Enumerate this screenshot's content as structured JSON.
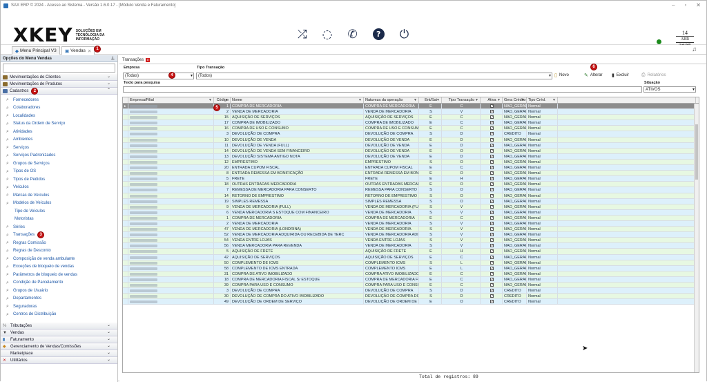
{
  "window_title": "SAX ERP © 2024 - Acesso ao Sistema - Versão 1.6.0.17 - [Módulo Venda e Faturamento]",
  "logo": {
    "mark": "XKEY",
    "tagline": "SOLUÇÕES EM TECNOLOGIA DA INFORMAÇÃO"
  },
  "date": {
    "day": "14",
    "month": "ABR",
    "year": "2025"
  },
  "tabs": [
    {
      "label": "Menu Principal V3"
    },
    {
      "label": "Vendas"
    }
  ],
  "badges": {
    "b1": "1",
    "b2": "2",
    "b3": "3",
    "b4": "4",
    "b5": "5",
    "b6": "6"
  },
  "sidebar": {
    "title": "Opções do Menu Vendas",
    "sections_top": [
      {
        "label": "Movimentações de Clientes"
      },
      {
        "label": "Movimentações de Produtos"
      },
      {
        "label": "Cadastros"
      }
    ],
    "items": [
      "Fornecedores",
      "Colaboradores",
      "Localidades",
      "Status da Ordem de Serviço",
      "Atividades",
      "Ambientes",
      "Serviços",
      "Serviços Padronizados",
      "Grupos de Serviços",
      "Tipos de OS",
      "Tipos de Pedidos",
      "Veículos",
      "Marcas de Veículos",
      "Modelos de Veículos",
      "Tipo de Veículos",
      "Motoristas",
      "Séries",
      "Transações",
      "Regras Comissão",
      "Regras de Desconto",
      "Composição de venda ambulante",
      "Exceções de bloqueio de vendas",
      "Parâmetros de bloqueio de vendas",
      "Condição de Parcelamento",
      "Grupos de Usuário",
      "Departamentos",
      "Seguradoras",
      "Centros de Distribuição"
    ],
    "sections_bottom": [
      {
        "label": "Tributações"
      },
      {
        "label": "Vendas"
      },
      {
        "label": "Faturamento"
      },
      {
        "label": "Gerenciamento de Vendas/Comissões"
      },
      {
        "label": "Marketplace"
      },
      {
        "label": "Utilitários"
      }
    ]
  },
  "content": {
    "tab_label": "Transações",
    "empresa_label": "Empresa",
    "empresa_value": "(Todas)",
    "tipo_label": "Tipo Transação",
    "tipo_value": "(Todos)",
    "search_label": "Texto para pesquisa",
    "situacao_label": "Situação",
    "situacao_value": "ATIVOS",
    "buttons": {
      "novo": "Novo",
      "alterar": "Alterar",
      "excluir": "Excluir",
      "relatorios": "Relatórios"
    },
    "columns": [
      "Empresa/Filial",
      "Código",
      "Nome",
      "Natureza da operação",
      "Ent/Sai",
      "Tipo Transação",
      "Ativa",
      "Gera Crédito",
      "Tipo Créd."
    ],
    "rows": [
      [
        "1",
        "COMPRA DE MERCADORIA",
        "COMPRA DE MERCADORIA",
        "E",
        "C",
        "NAO_GERAR",
        "Normal"
      ],
      [
        "2",
        "VENDA DE MERCADORIA",
        "VENDA DE MERCADORIA",
        "S",
        "V",
        "NAO_GERAR",
        "Normal"
      ],
      [
        "15",
        "AQUISIÇÃO DE SERVIÇOS",
        "AQUISIÇÃO DE SERVIÇOS",
        "E",
        "C",
        "NAO_GERAR",
        "Normal"
      ],
      [
        "17",
        "COMPRA DE IMOBILIZADO",
        "COMPRA DE IMOBILIZADO",
        "E",
        "C",
        "NAO_GERAR",
        "Normal"
      ],
      [
        "16",
        "COMPRA DE USO E CONSUMO",
        "COMPRA DE USO E CONSUM",
        "E",
        "C",
        "NAO_GERAR",
        "Normal"
      ],
      [
        "3",
        "DEVOLUÇÃO DE COMPRA",
        "DEVOLUÇÃO DE COMPRA",
        "S",
        "D",
        "CREDITO",
        "Normal"
      ],
      [
        "10",
        "DEVOLUÇÃO DE VENDA",
        "DEVOLUÇÃO DE VENDA",
        "E",
        "D",
        "NAO_GERAR",
        "Normal"
      ],
      [
        "11",
        "DEVOLUÇÃO DE VENDA (FULL)",
        "DEVOLUÇÃO DE VENDA",
        "E",
        "D",
        "NAO_GERAR",
        "Normal"
      ],
      [
        "14",
        "DEVOLUÇÃO DE VENDA SEM FINANCEIRO",
        "DEVOLUÇÃO DE VENDA",
        "E",
        "O",
        "NAO_GERAR",
        "Normal"
      ],
      [
        "13",
        "DEVOLUÇÃO SISTEMA ANTIGO NOTA",
        "DEVOLUÇÃO DE VENDA",
        "E",
        "D",
        "NAO_GERAR",
        "Normal"
      ],
      [
        "12",
        "EMPRESTIMO",
        "EMPRESTIMO",
        "S",
        "O",
        "NAO_GERAR",
        "Normal"
      ],
      [
        "20",
        "ENTRADA CUPOM FISCAL",
        "ENTRADA CUPOM FISCAL",
        "E",
        "C",
        "NAO_GERAR",
        "Normal"
      ],
      [
        "8",
        "ENTRADA REMESSA EM BONIFICAÇÃO",
        "ENTRADA REMESSA EM BONII",
        "E",
        "O",
        "NAO_GERAR",
        "Normal"
      ],
      [
        "5",
        "FRETE",
        "FRETE",
        "E",
        "H",
        "NAO_GERAR",
        "Normal"
      ],
      [
        "18",
        "OUTRAS ENTRADAS MERCADORIA",
        "OUTRAS ENTRADAS MERCAD",
        "E",
        "O",
        "NAO_GERAR",
        "Normal"
      ],
      [
        "7",
        "REMESSA DE MERCADORIA PARA CONSERTO",
        "REMESSA PARA CONSERTO",
        "S",
        "O",
        "NAO_GERAR",
        "Normal"
      ],
      [
        "14",
        "RETORNO DE EMPRESTIMO",
        "RETORNO DE EMPRESTIMO",
        "S",
        "O",
        "NAO_GERAR",
        "Normal"
      ],
      [
        "19",
        "SIMPLES REMESSA",
        "SIMPLES REMESSA",
        "S",
        "O",
        "NAO_GERAR",
        "Normal"
      ],
      [
        "9",
        "VENDA DE MERCADORIA (FULL)",
        "VENDA DE MERCADORIA (FUI",
        "S",
        "V",
        "NAO_GERAR",
        "Normal"
      ],
      [
        "6",
        "VENDA MERCADORIA S ESTOQUE COM FINANCEIRO",
        "VENDA DE MERCADORIA",
        "S",
        "V",
        "NAO_GERAR",
        "Normal"
      ],
      [
        "1",
        "COMPRA DE MERCADORIA",
        "COMPRA DE MERCADORIA",
        "E",
        "C",
        "NAO_GERAR",
        "Normal"
      ],
      [
        "2",
        "VENDA DE MERCADORIA",
        "VENDA DE MERCADORIA",
        "S",
        "V",
        "NAO_GERAR",
        "Normal"
      ],
      [
        "47",
        "VENDA DE MERCADORIA (LONDRINA)",
        "VENDA DE MERCADORIA",
        "S",
        "V",
        "NAO_GERAR",
        "Normal"
      ],
      [
        "52",
        "VENDA DE MERCADORIA ADQUIRIDA OU RECEBIDA DE TERC",
        "VENDA DE MERCADORIA ADI",
        "S",
        "V",
        "NAO_GERAR",
        "Normal"
      ],
      [
        "54",
        "VENDA ENTRE LOJAS",
        "VENDA ENTRE LOJAS",
        "S",
        "V",
        "NAO_GERAR",
        "Normal"
      ],
      [
        "56",
        "VENDA MERCADORIA PARA REVENDA",
        "VENDA DE MERCADORIA",
        "S",
        "V",
        "NAO_GERAR",
        "Normal"
      ],
      [
        "5",
        "AQUISIÇÃO DE FRETE",
        "AQUISIÇÃO DE FRETE",
        "E",
        "H",
        "NAO_GERAR",
        "Normal"
      ],
      [
        "42",
        "AQUISIÇÃO DE SERVIÇOS",
        "AQUISIÇÃO DE SERVIÇOS",
        "E",
        "C",
        "NAO_GERAR",
        "Normal"
      ],
      [
        "50",
        "COMPLEMENTO DE ICMS",
        "COMPLEMENTO ICMS",
        "S",
        "L",
        "NAO_GERAR",
        "Normal"
      ],
      [
        "58",
        "COMPLEMENTO DE ICMS ENTRADA",
        "COMPLEMENTO ICMS",
        "E",
        "L",
        "NAO_GERAR",
        "Normal"
      ],
      [
        "31",
        "COMPRA DE ATIVO IMOBILIZADO",
        "COMPRA ATIVO IMOBILIZADO",
        "E",
        "C",
        "NAO_GERAR",
        "Normal"
      ],
      [
        "18",
        "COMPRA DE MERCADORIA FISCAL S/ ESTOQUE",
        "COMPRA DE MERCADORIA FI",
        "E",
        "C",
        "NAO_GERAR",
        "Normal"
      ],
      [
        "39",
        "COMPRA PARA USO E CONSUMO",
        "COMPRA PARA USO E CONSU",
        "E",
        "C",
        "NAO_GERAR",
        "Normal"
      ],
      [
        "3",
        "DEVOLUÇÃO DE COMPRA",
        "DEVOLUÇÃO DE COMPRA",
        "S",
        "D",
        "CREDITO",
        "Normal"
      ],
      [
        "30",
        "DEVOLUÇÃO DE COMPRA DO ATIVO IMOBILIZADO",
        "DEVOLUÇÃO DE COMPRA DC",
        "S",
        "D",
        "CREDITO",
        "Normal"
      ],
      [
        "49",
        "DEVOLUÇÃO DE ORDEM DE SERVIÇO",
        "DEVOLUÇÃO DE ORDEM DE S",
        "E",
        "O",
        "CREDITO",
        "Normal"
      ]
    ],
    "footer": "Total de registros: 89"
  }
}
